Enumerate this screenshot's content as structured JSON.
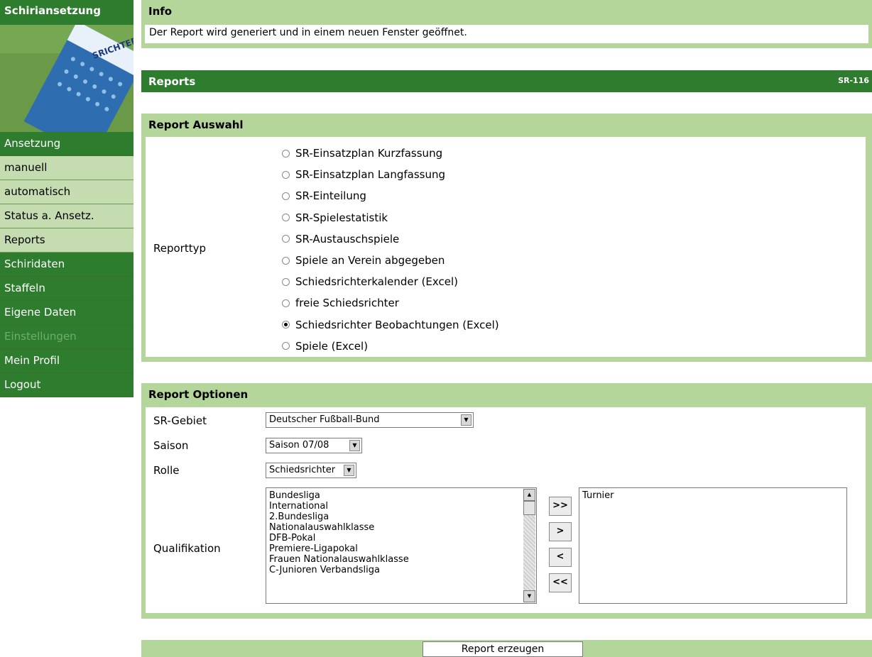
{
  "sidebar": {
    "title": "Schiriansetzung",
    "image_label": "SRICHTER",
    "items": [
      {
        "label": "Ansetzung",
        "style": "dark"
      },
      {
        "label": "manuell",
        "style": "light"
      },
      {
        "label": "automatisch",
        "style": "light"
      },
      {
        "label": "Status a. Ansetz.",
        "style": "light"
      },
      {
        "label": "Reports",
        "style": "light"
      },
      {
        "label": "Schiridaten",
        "style": "dark"
      },
      {
        "label": "Staffeln",
        "style": "dark"
      },
      {
        "label": "Eigene Daten",
        "style": "dark"
      },
      {
        "label": "Einstellungen",
        "style": "disabled"
      },
      {
        "label": "Mein Profil",
        "style": "dark"
      },
      {
        "label": "Logout",
        "style": "dark"
      }
    ]
  },
  "info": {
    "title": "Info",
    "message": "Der Report wird generiert und in einem neuen Fenster geöffnet."
  },
  "reports_bar": {
    "title": "Reports",
    "code": "SR-116"
  },
  "auswahl": {
    "title": "Report Auswahl",
    "reporttyp_label": "Reporttyp",
    "options": [
      {
        "label": "SR-Einsatzplan Kurzfassung",
        "checked": false
      },
      {
        "label": "SR-Einsatzplan Langfassung",
        "checked": false
      },
      {
        "label": "SR-Einteilung",
        "checked": false
      },
      {
        "label": "SR-Spielestatistik",
        "checked": false
      },
      {
        "label": "SR-Austauschspiele",
        "checked": false
      },
      {
        "label": "Spiele an Verein abgegeben",
        "checked": false
      },
      {
        "label": "Schiedsrichterkalender (Excel)",
        "checked": false
      },
      {
        "label": "freie Schiedsrichter",
        "checked": false
      },
      {
        "label": "Schiedsrichter Beobachtungen (Excel)",
        "checked": true
      },
      {
        "label": "Spiele (Excel)",
        "checked": false
      }
    ]
  },
  "optionen": {
    "title": "Report Optionen",
    "gebiet_label": "SR-Gebiet",
    "gebiet_value": "Deutscher Fußball-Bund",
    "saison_label": "Saison",
    "saison_value": "Saison 07/08",
    "rolle_label": "Rolle",
    "rolle_value": "Schiedsrichter",
    "qualifikation_label": "Qualifikation",
    "available": [
      "Bundesliga",
      "International",
      "2.Bundesliga",
      "Nationalauswahlklasse",
      "DFB-Pokal",
      "Premiere-Ligapokal",
      "Frauen Nationalauswahlklasse",
      "C-Junioren Verbandsliga"
    ],
    "selected": [
      "Turnier"
    ],
    "buttons": {
      "add_all": ">>",
      "add": ">",
      "remove": "<",
      "remove_all": "<<"
    }
  },
  "submit_label": "Report erzeugen"
}
